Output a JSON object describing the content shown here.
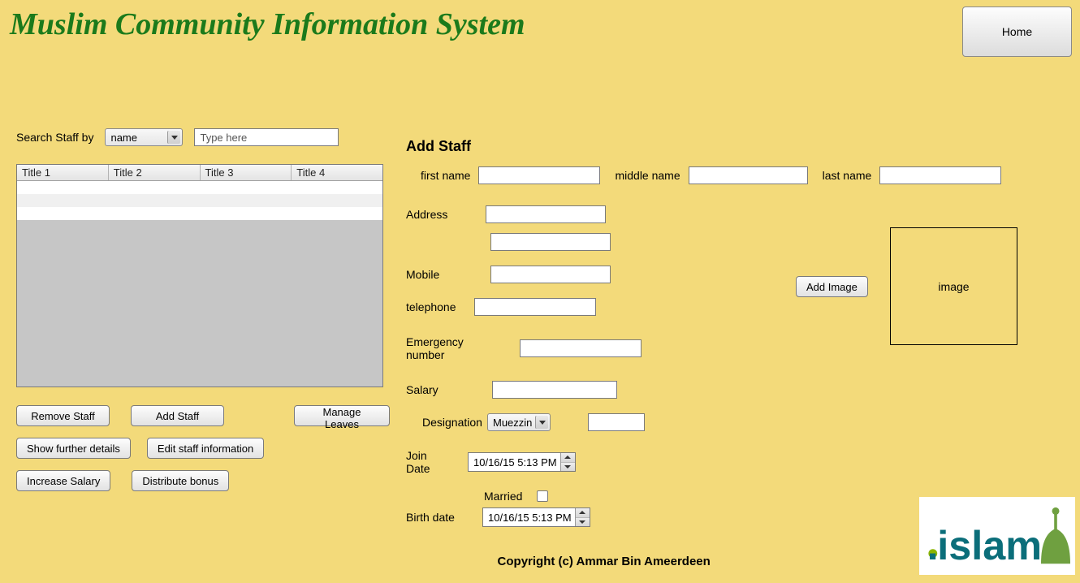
{
  "header": {
    "title": "Muslim Community Information System",
    "home_btn": "Home"
  },
  "search": {
    "label": "Search Staff by",
    "criteria_selected": "name",
    "placeholder": "Type here"
  },
  "table": {
    "columns": [
      "Title 1",
      "Title 2",
      "Title 3",
      "Title 4"
    ]
  },
  "left_buttons": {
    "remove": "Remove Staff",
    "add": "Add Staff",
    "manage_leaves": "Manage Leaves",
    "details": "Show further details",
    "edit": "Edit staff information",
    "increase": "Increase Salary",
    "bonus": "Distribute bonus"
  },
  "form": {
    "section_title": "Add Staff",
    "first_name_lbl": "first name",
    "middle_name_lbl": "middle name",
    "last_name_lbl": "last name",
    "address_lbl": "Address",
    "mobile_lbl": "Mobile",
    "telephone_lbl": "telephone",
    "emergency_lbl": "Emergency number",
    "salary_lbl": "Salary",
    "designation_lbl": "Designation",
    "designation_selected": "Muezzin",
    "join_date_lbl": "Join Date",
    "join_date_value": "10/16/15 5:13 PM",
    "married_lbl": "Married",
    "birth_date_lbl": "Birth date",
    "birth_date_value": "10/16/15 5:13 PM",
    "add_image_btn": "Add Image",
    "image_placeholder": "image"
  },
  "footer": {
    "copyright": "Copyright (c) Ammar Bin Ameerdeen"
  }
}
